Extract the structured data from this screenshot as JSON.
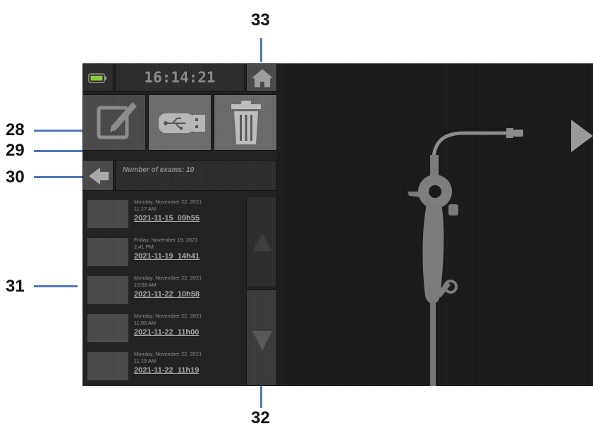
{
  "callouts": {
    "c28": "28",
    "c29": "29",
    "c30": "30",
    "c31": "31",
    "c32": "32",
    "c33": "33"
  },
  "status_bar": {
    "time": "16:14:21",
    "battery_icon": "battery-icon",
    "home_icon": "home-icon"
  },
  "toolbar": {
    "edit_icon": "edit-icon",
    "usb_icon": "usb-icon",
    "trash_icon": "trash-icon",
    "back_icon": "back-arrow-icon"
  },
  "exam_info": {
    "count_label": "Number of exams: 10"
  },
  "exams": [
    {
      "day": "Monday, November 22, 2021",
      "time": "11:17 AM",
      "name": "2021-11-15_09h55"
    },
    {
      "day": "Friday, November 19, 2021",
      "time": "2:41 PM",
      "name": "2021-11-19_14h41"
    },
    {
      "day": "Monday, November 22, 2021",
      "time": "10:58 AM",
      "name": "2021-11-22_10h58"
    },
    {
      "day": "Monday, November 22, 2021",
      "time": "11:00 AM",
      "name": "2021-11-22_11h00"
    },
    {
      "day": "Monday, November 22, 2021",
      "time": "11:19 AM",
      "name": "2021-11-22_11h19"
    }
  ],
  "scroll": {
    "up_icon": "triangle-up-icon",
    "down_icon": "triangle-down-icon"
  },
  "preview": {
    "image": "endoscope-illustration",
    "next_icon": "play-icon"
  },
  "colors": {
    "callout_line": "#4f77b7",
    "battery_fill": "#8dd13a",
    "screen_bg": "#1e1e1e"
  }
}
